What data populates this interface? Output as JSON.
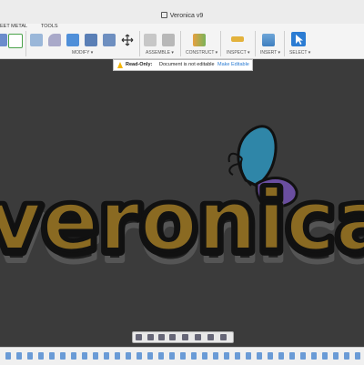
{
  "window": {
    "title": "Veronica v9"
  },
  "toolbar": {
    "tabs": [
      {
        "label": "EET METAL"
      },
      {
        "label": "TOOLS"
      }
    ],
    "groups": [
      {
        "label": "MODIFY ▾"
      },
      {
        "label": "ASSEMBLE ▾"
      },
      {
        "label": "CONSTRUCT ▾"
      },
      {
        "label": "INSPECT ▾"
      },
      {
        "label": "INSERT ▾"
      },
      {
        "label": "SELECT ▾"
      }
    ]
  },
  "readonly_banner": {
    "status": "Read-Only:",
    "message": "Document is not editable",
    "action": "Make Editable"
  },
  "colors": {
    "viewport_bg": "#3b3b3b",
    "text_fill": "#8a6a22",
    "outline": "#111111",
    "butterfly_blue": "#2f86a8",
    "butterfly_purple": "#6a4ea0",
    "accent_blue": "#2b7cd3"
  }
}
